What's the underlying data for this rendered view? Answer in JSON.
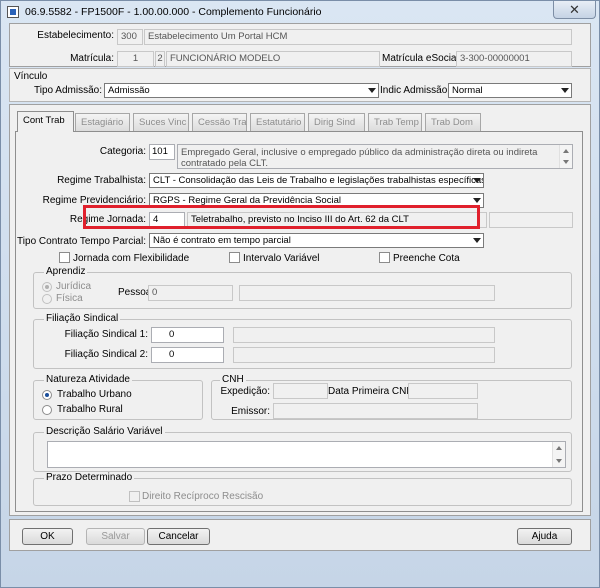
{
  "window": {
    "title": "06.9.5582 - FP1500F - 1.00.00.000 - Complemento Funcionário",
    "close": "✕"
  },
  "header": {
    "estabelecimento_label": "Estabelecimento:",
    "estabelecimento_code": "300",
    "estabelecimento_name": "Estabelecimento Um Portal HCM",
    "matricula_label": "Matrícula:",
    "matricula_num1": "1",
    "matricula_num2": "2",
    "matricula_name": "FUNCIONÁRIO MODELO",
    "matricula_esocial_label": "Matrícula eSocial:",
    "matricula_esocial_value": "3-300-00000001"
  },
  "vinculo": {
    "title": "Vínculo",
    "tipo_admissao_label": "Tipo Admissão:",
    "tipo_admissao_value": "Admissão",
    "indic_admissao_label": "Indic Admissão:",
    "indic_admissao_value": "Normal"
  },
  "tabs": [
    {
      "label": "Cont Trab"
    },
    {
      "label": "Estagiário"
    },
    {
      "label": "Suces Vinc"
    },
    {
      "label": "Cessão Tra"
    },
    {
      "label": "Estatutário"
    },
    {
      "label": "Dirig Sind"
    },
    {
      "label": "Trab Temp"
    },
    {
      "label": "Trab Dom"
    }
  ],
  "cont_trab": {
    "categoria_label": "Categoria:",
    "categoria_code": "101",
    "categoria_desc": "Empregado Geral, inclusive o empregado público da administração direta ou indireta contratado pela CLT.",
    "regime_trabalhista_label": "Regime Trabalhista:",
    "regime_trabalhista_value": "CLT - Consolidação das Leis de Trabalho e legislações trabalhistas específicas",
    "regime_previdenciario_label": "Regime Previdenciário:",
    "regime_previdenciario_value": "RGPS - Regime Geral da Previdência Social",
    "regime_jornada_label": "Regime Jornada:",
    "regime_jornada_code": "4",
    "regime_jornada_desc": "Teletrabalho, previsto no Inciso III do Art. 62 da CLT",
    "tipo_contrato_label": "Tipo Contrato Tempo Parcial:",
    "tipo_contrato_value": "Não é contrato em tempo parcial",
    "jornada_flex_label": "Jornada com Flexibilidade",
    "intervalo_variavel_label": "Intervalo Variável",
    "preenche_cota_label": "Preenche Cota",
    "aprendiz": {
      "title": "Aprendiz",
      "juridica_label": "Jurídica",
      "fisica_label": "Física",
      "pessoa_label": "Pessoa:",
      "pessoa_value": "0"
    },
    "filiacao": {
      "title": "Filiação Sindical",
      "sindical1_label": "Filiação Sindical 1:",
      "sindical1_value": "0",
      "sindical2_label": "Filiação Sindical 2:",
      "sindical2_value": "0"
    },
    "natureza": {
      "title": "Natureza Atividade",
      "urbano_label": "Trabalho Urbano",
      "rural_label": "Trabalho Rural"
    },
    "cnh": {
      "title": "CNH",
      "expedicao_label": "Expedição:",
      "data_primeira_label": "Data Primeira CNH:",
      "emissor_label": "Emissor:"
    },
    "descricao_salario_title": "Descrição Salário Variável",
    "prazo": {
      "title": "Prazo Determinado",
      "direito_label": "Direito Recíproco Rescisão"
    }
  },
  "buttons": {
    "ok": "OK",
    "salvar": "Salvar",
    "cancelar": "Cancelar",
    "ajuda": "Ajuda"
  },
  "colors": {
    "highlight": "#e0202c",
    "window_frame": "#c6d5e7"
  }
}
